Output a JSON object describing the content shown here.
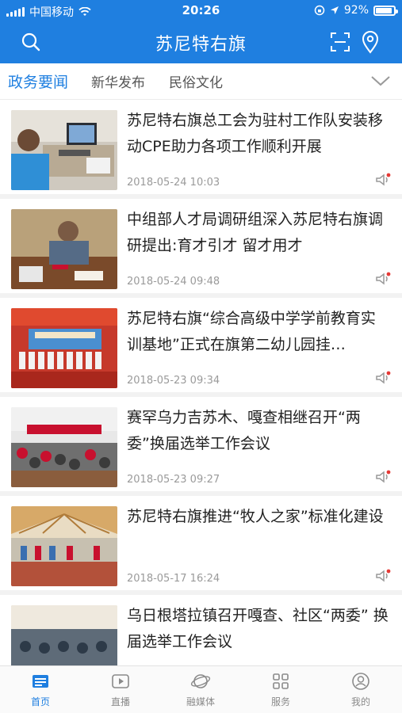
{
  "status_bar": {
    "carrier": "中国移动",
    "time": "20:26",
    "battery": "92%",
    "battery_level": 0.92
  },
  "header": {
    "title": "苏尼特右旗",
    "search_icon": "search-icon",
    "scan_icon": "scan-icon",
    "location_icon": "location-pin-icon"
  },
  "tabs": [
    {
      "label": "政务要闻",
      "active": true
    },
    {
      "label": "新华发布",
      "active": false
    },
    {
      "label": "民俗文化",
      "active": false
    }
  ],
  "news": [
    {
      "title": "苏尼特右旗总工会为驻村工作队安装移动CPE助力各项工作顺利开展",
      "date": "2018-05-24 10:03"
    },
    {
      "title": "中组部人才局调研组深入苏尼特右旗调研提出:育才引才 留才用才",
      "date": "2018-05-24 09:48"
    },
    {
      "title": "苏尼特右旗“综合高级中学学前教育实训基地”正式在旗第二幼儿园挂…",
      "date": "2018-05-23 09:34"
    },
    {
      "title": "赛罕乌力吉苏木、嘎查相继召开“两委”换届选举工作会议",
      "date": "2018-05-23 09:27"
    },
    {
      "title": "苏尼特右旗推进“牧人之家”标准化建设",
      "date": "2018-05-17 16:24"
    },
    {
      "title": "乌日根塔拉镇召开嘎查、社区“两委” 换届选举工作会议",
      "date": ""
    }
  ],
  "tabbar": [
    {
      "label": "首页",
      "icon": "news-icon",
      "active": true
    },
    {
      "label": "直播",
      "icon": "live-play-icon",
      "active": false
    },
    {
      "label": "融媒体",
      "icon": "media-planet-icon",
      "active": false
    },
    {
      "label": "服务",
      "icon": "grid-services-icon",
      "active": false
    },
    {
      "label": "我的",
      "icon": "profile-icon",
      "active": false
    }
  ],
  "colors": {
    "brand": "#1f7fe0",
    "text": "#222222",
    "muted": "#9a9a9a",
    "divider": "#f2f2f2",
    "speaker_dot": "#e53935"
  }
}
